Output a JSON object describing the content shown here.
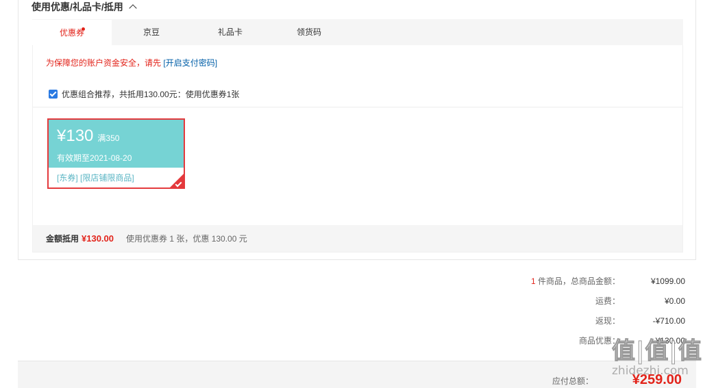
{
  "section": {
    "title": "使用优惠/礼品卡/抵用"
  },
  "tabs": [
    {
      "label": "优惠券"
    },
    {
      "label": "京豆"
    },
    {
      "label": "礼品卡"
    },
    {
      "label": "领货码"
    }
  ],
  "security": {
    "text": "为保障您的账户资金安全，请先",
    "link": "[开启支付密码]"
  },
  "combo": {
    "text": "优惠组合推荐，共抵用130.00元：使用优惠券1张",
    "checked": true
  },
  "coupon": {
    "amount": "¥130",
    "condition": "满350",
    "valid": "有效期至2021-08-20",
    "tags": "[东券]  [限店铺限商品]"
  },
  "summary": {
    "label": "金额抵用",
    "amount": "¥130.00",
    "desc": "使用优惠券 1 张，优惠 130.00 元"
  },
  "totals": {
    "items_count": "1",
    "items_label": " 件商品，总商品金额：",
    "items_value": "¥1099.00",
    "shipping_label": "运费：",
    "shipping_value": "¥0.00",
    "cashback_label": "返现：",
    "cashback_value": "-¥710.00",
    "discount_label": "商品优惠：",
    "discount_value": "-¥130.00"
  },
  "pay": {
    "label": "应付总额：",
    "value": "¥259.00"
  },
  "watermark": {
    "logo": "值|值|值",
    "site": "zhidezhi.com"
  },
  "colors": {
    "accent": "#e2231a",
    "coupon": "#76d3d4",
    "link": "#005ea7"
  }
}
